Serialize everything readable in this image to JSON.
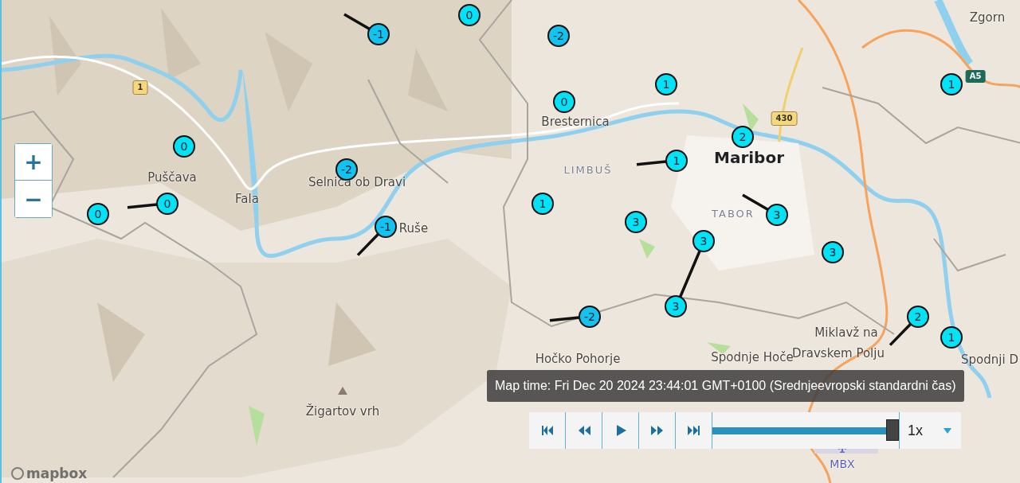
{
  "map": {
    "places": [
      {
        "kind": "town",
        "name": "Zgorn"
      },
      {
        "kind": "town",
        "name": "Bresternica"
      },
      {
        "kind": "city",
        "name": "Maribor"
      },
      {
        "kind": "district",
        "name": "LIMBUŠ"
      },
      {
        "kind": "town",
        "name": "Puščava"
      },
      {
        "kind": "town",
        "name": "Selnica ob Dravi"
      },
      {
        "kind": "town",
        "name": "Fala"
      },
      {
        "kind": "district",
        "name": "TABOR"
      },
      {
        "kind": "town",
        "name": "Ruše"
      },
      {
        "kind": "town",
        "name": "Miklavž na"
      },
      {
        "kind": "town",
        "name": "Dravskem Polju"
      },
      {
        "kind": "town",
        "name": "Hočko Pohorje"
      },
      {
        "kind": "town",
        "name": "Spodnje Hoče"
      },
      {
        "kind": "town",
        "name": "Spodnji D"
      },
      {
        "kind": "peak",
        "name": "Žigartov vrh"
      },
      {
        "kind": "airport",
        "name": "MBX"
      }
    ],
    "road_shields": [
      {
        "kind": "state",
        "label": "1"
      },
      {
        "kind": "state",
        "label": "430"
      },
      {
        "kind": "motorway",
        "label": "A5"
      }
    ],
    "markers": [
      {
        "value": "-1",
        "color": "#12c3ef",
        "kind": "tailed"
      },
      {
        "value": "0",
        "color": "#00e2f6",
        "kind": "plain"
      },
      {
        "value": "-2",
        "color": "#12c3ef",
        "kind": "plain"
      },
      {
        "value": "1",
        "color": "#00e2f6",
        "kind": "plain"
      },
      {
        "value": "1",
        "color": "#00e2f6",
        "kind": "plain"
      },
      {
        "value": "0",
        "color": "#00e2f6",
        "kind": "plain"
      },
      {
        "value": "0",
        "color": "#00e2f6",
        "kind": "plain"
      },
      {
        "value": "2",
        "color": "#00e2f6",
        "kind": "plain"
      },
      {
        "value": "-2",
        "color": "#12c3ef",
        "kind": "plain"
      },
      {
        "value": "1",
        "color": "#00e2f6",
        "kind": "tailed"
      },
      {
        "value": "0",
        "color": "#00e2f6",
        "kind": "tailed"
      },
      {
        "value": "0",
        "color": "#00e2f6",
        "kind": "plain"
      },
      {
        "value": "1",
        "color": "#00e2f6",
        "kind": "plain"
      },
      {
        "value": "3",
        "color": "#00e2f6",
        "kind": "tailed"
      },
      {
        "value": "3",
        "color": "#00e2f6",
        "kind": "plain"
      },
      {
        "value": "-1",
        "color": "#12c3ef",
        "kind": "tailed"
      },
      {
        "value": "3",
        "color": "#00e2f6",
        "kind": "tailed"
      },
      {
        "value": "3",
        "color": "#00e2f6",
        "kind": "plain"
      },
      {
        "value": "3",
        "color": "#00e2f6",
        "kind": "plain"
      },
      {
        "value": "-2",
        "color": "#12c3ef",
        "kind": "tailed"
      },
      {
        "value": "2",
        "color": "#00e2f6",
        "kind": "tailed"
      },
      {
        "value": "1",
        "color": "#00e2f6",
        "kind": "plain"
      }
    ],
    "zoom_controls": [
      {
        "kind": "in",
        "label": "+"
      },
      {
        "kind": "out",
        "label": "−"
      }
    ],
    "attribution": "mapbox"
  },
  "time_tooltip": "Map time: Fri Dec 20 2024 23:44:01 GMT+0100 (Srednjeevropski standardni čas)",
  "player": {
    "buttons": [
      {
        "kind": "first"
      },
      {
        "kind": "back"
      },
      {
        "kind": "play"
      },
      {
        "kind": "forward"
      },
      {
        "kind": "last"
      }
    ],
    "timeline": {
      "level": 1
    },
    "speed": "1x"
  }
}
